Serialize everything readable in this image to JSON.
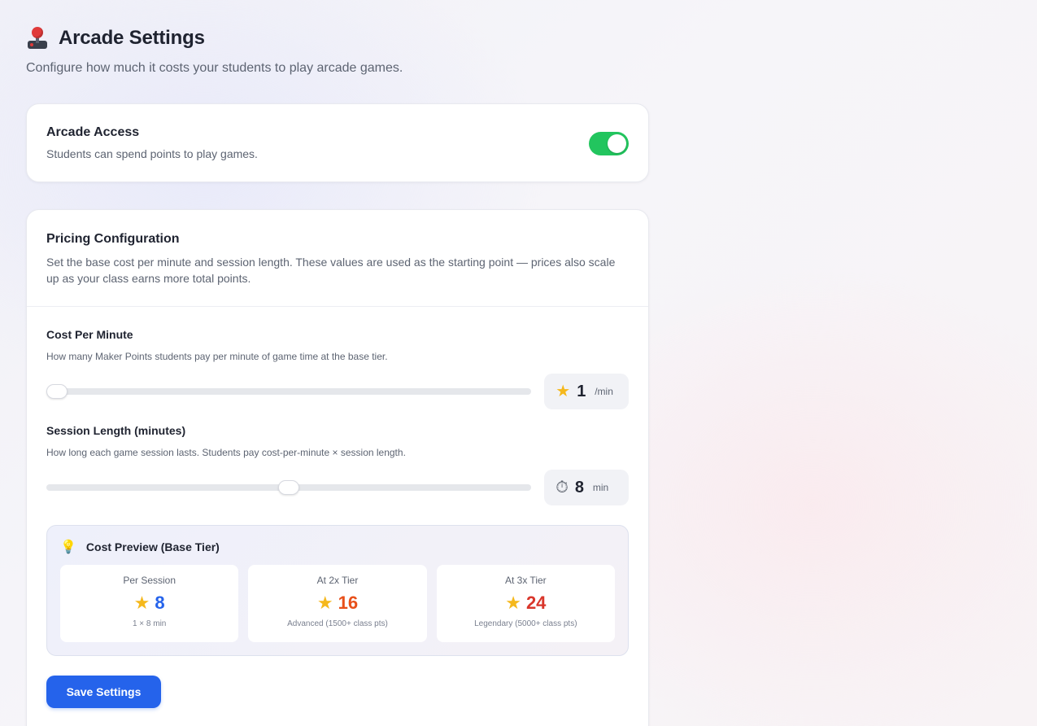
{
  "header": {
    "icon": "joystick-icon",
    "title": "Arcade Settings",
    "subtitle": "Configure how much it costs your students to play arcade games."
  },
  "access": {
    "title": "Arcade Access",
    "description": "Students can spend points to play games.",
    "enabled": true,
    "toggle_color": "#22c55e"
  },
  "pricing": {
    "title": "Pricing Configuration",
    "description": "Set the base cost per minute and session length. These values are used as the starting point — prices also scale up as your class earns more total points.",
    "cost_per_minute": {
      "label": "Cost Per Minute",
      "help": "How many Maker Points students pay per minute of game time at the base tier.",
      "icon": "star-icon",
      "value": "1",
      "unit": "/min",
      "slider_fraction": 0.0
    },
    "session_length": {
      "label": "Session Length (minutes)",
      "help": "How long each game session lasts. Students pay cost-per-minute × session length.",
      "icon": "stopwatch-icon",
      "value": "8",
      "unit": "min",
      "slider_fraction": 0.5
    },
    "preview": {
      "icon": "lightbulb-icon",
      "title": "Cost Preview (Base Tier)",
      "tiles": [
        {
          "label": "Per Session",
          "value": "8",
          "sub": "1 × 8 min",
          "color": "#2563eb"
        },
        {
          "label": "At 2x Tier",
          "value": "16",
          "sub": "Advanced (1500+ class pts)",
          "color": "#e8501a"
        },
        {
          "label": "At 3x Tier",
          "value": "24",
          "sub": "Legendary (5000+ class pts)",
          "color": "#d9362b"
        }
      ]
    },
    "save_label": "Save Settings",
    "accent": "#2563eb"
  }
}
